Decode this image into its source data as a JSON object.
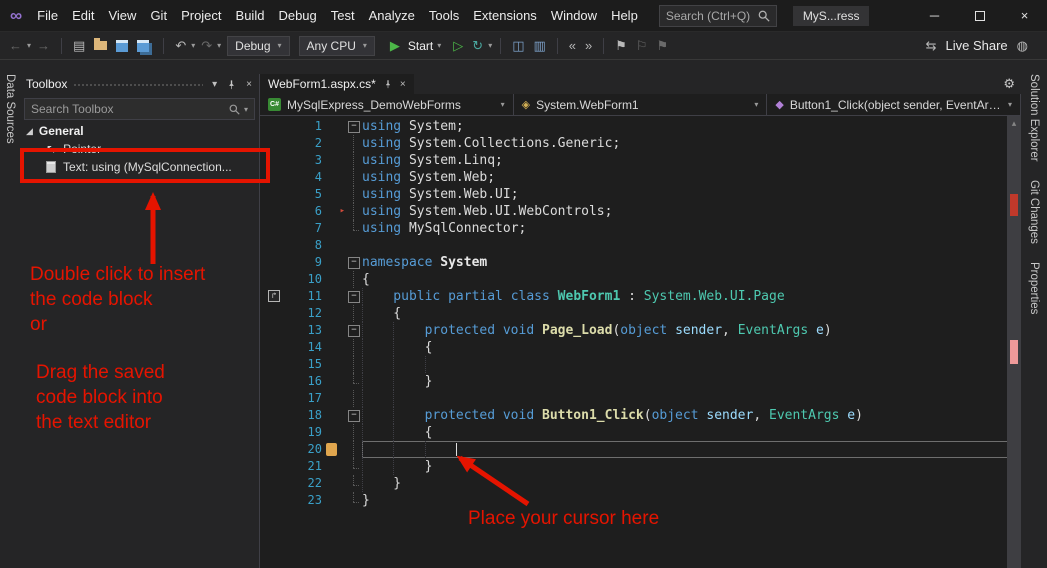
{
  "colors": {
    "annotation_red": "#e51400",
    "keyword_blue": "#569cd6",
    "type_teal": "#4ec9b0",
    "method_yellow": "#dcdcaa"
  },
  "icons": {
    "logo": "∞",
    "minimize": "─",
    "close": "×",
    "back": "←",
    "forward": "→",
    "undo": "↶",
    "redo": "↷",
    "new_item": "▤",
    "start_play": "▶",
    "run_play": "▷",
    "hot_reload": "↻",
    "panel1": "◫",
    "panel2": "▥",
    "indent_out": "«",
    "indent_in": "»",
    "bookmark": "⚑",
    "bookmark2": "⚐",
    "live_share": "⇆",
    "feedback": "◍",
    "gear": "⚙",
    "chevron": "▾",
    "scroll_up": "▴",
    "pointer": "↖",
    "expander": "◢",
    "tracker": "▸",
    "margin_glyph": "↱",
    "tab_close": "×"
  },
  "titlebar": {
    "menu": [
      "File",
      "Edit",
      "View",
      "Git",
      "Project",
      "Build",
      "Debug",
      "Test",
      "Analyze",
      "Tools",
      "Extensions",
      "Window",
      "Help"
    ],
    "search_placeholder": "Search (Ctrl+Q)",
    "window_title": "MyS...ress"
  },
  "toolbar": {
    "debug_target": "Debug",
    "platform": "Any CPU",
    "start_label": "Start",
    "live_share_label": "Live Share"
  },
  "left_strip": {
    "tab": "Data Sources"
  },
  "toolbox": {
    "title": "Toolbox",
    "search_placeholder": "Search Toolbox",
    "section_label": "General",
    "items": [
      {
        "label": "Pointer"
      },
      {
        "label": "Text: using (MySqlConnection..."
      }
    ]
  },
  "annotations": {
    "note_top": "Double click to insert\nthe code block\nor",
    "note_bottom": "Drag the saved\ncode block into\nthe text editor",
    "cursor_note": "Place your cursor here"
  },
  "editor": {
    "tab_label": "WebForm1.aspx.cs*",
    "nav_project": "MySqlExpress_DemoWebForms",
    "nav_type": "System.WebForm1",
    "nav_member": "Button1_Click(object sender, EventArgs)",
    "code_lines": [
      {
        "n": 1,
        "fold": "fb",
        "guides": 0,
        "tokens": [
          [
            "kw",
            "using"
          ],
          [
            "pl",
            " System;"
          ]
        ]
      },
      {
        "n": 2,
        "fold": "fl",
        "guides": 0,
        "tokens": [
          [
            "kw",
            "using"
          ],
          [
            "pl",
            " System.Collections.Generic;"
          ]
        ]
      },
      {
        "n": 3,
        "fold": "fl",
        "guides": 0,
        "tokens": [
          [
            "kw",
            "using"
          ],
          [
            "pl",
            " System.Linq;"
          ]
        ]
      },
      {
        "n": 4,
        "fold": "fl",
        "guides": 0,
        "tokens": [
          [
            "kw",
            "using"
          ],
          [
            "pl",
            " System.Web;"
          ]
        ]
      },
      {
        "n": 5,
        "fold": "fl",
        "guides": 0,
        "tokens": [
          [
            "kw",
            "using"
          ],
          [
            "pl",
            " System.Web.UI;"
          ]
        ]
      },
      {
        "n": 6,
        "fold": "fl",
        "guides": 0,
        "marker": "redarrow",
        "tokens": [
          [
            "kw",
            "using"
          ],
          [
            "pl",
            " System.Web.UI.WebControls;"
          ]
        ]
      },
      {
        "n": 7,
        "fold": "fe",
        "guides": 0,
        "tokens": [
          [
            "kw",
            "using"
          ],
          [
            "pl",
            " MySqlConnector;"
          ]
        ]
      },
      {
        "n": 8,
        "fold": "",
        "guides": 0,
        "tokens": []
      },
      {
        "n": 9,
        "fold": "fb",
        "guides": 0,
        "tokens": [
          [
            "kw",
            "namespace"
          ],
          [
            "ns",
            " System"
          ]
        ]
      },
      {
        "n": 10,
        "fold": "fl",
        "guides": 0,
        "tokens": [
          [
            "pl",
            "{"
          ]
        ]
      },
      {
        "n": 11,
        "fold": "fb",
        "guides": 1,
        "lmicon": true,
        "tokens": [
          [
            "kw",
            "public partial class"
          ],
          [
            "tyb",
            " WebForm1"
          ],
          [
            "pl",
            " : "
          ],
          [
            "ty",
            "System.Web.UI.Page"
          ]
        ]
      },
      {
        "n": 12,
        "fold": "fl",
        "guides": 1,
        "tokens": [
          [
            "pl",
            "{"
          ]
        ]
      },
      {
        "n": 13,
        "fold": "fb",
        "guides": 2,
        "tokens": [
          [
            "kw",
            "protected void"
          ],
          [
            "meb",
            " Page_Load"
          ],
          [
            "pl",
            "("
          ],
          [
            "kw",
            "object"
          ],
          [
            "pa",
            " sender"
          ],
          [
            "pl",
            ", "
          ],
          [
            "ty",
            "EventArgs"
          ],
          [
            "pa",
            " e"
          ],
          [
            "pl",
            ")"
          ]
        ]
      },
      {
        "n": 14,
        "fold": "fl",
        "guides": 2,
        "tokens": [
          [
            "pl",
            "{"
          ]
        ]
      },
      {
        "n": 15,
        "fold": "fl",
        "guides": 3,
        "tokens": []
      },
      {
        "n": 16,
        "fold": "fe",
        "guides": 2,
        "tokens": [
          [
            "pl",
            "}"
          ]
        ]
      },
      {
        "n": 17,
        "fold": "fl",
        "guides": 2,
        "tokens": []
      },
      {
        "n": 18,
        "fold": "fb",
        "guides": 2,
        "tokens": [
          [
            "kw",
            "protected void"
          ],
          [
            "meb",
            " Button1_Click"
          ],
          [
            "pl",
            "("
          ],
          [
            "kw",
            "object"
          ],
          [
            "pa",
            " sender"
          ],
          [
            "pl",
            ", "
          ],
          [
            "ty",
            "EventArgs"
          ],
          [
            "pa",
            " e"
          ],
          [
            "pl",
            ")"
          ]
        ]
      },
      {
        "n": 19,
        "fold": "fl",
        "guides": 2,
        "tokens": [
          [
            "pl",
            "{"
          ]
        ]
      },
      {
        "n": 20,
        "fold": "fl",
        "guides": 3,
        "current": true,
        "caret": true,
        "marker": "modified",
        "tokens": []
      },
      {
        "n": 21,
        "fold": "fe",
        "guides": 2,
        "tokens": [
          [
            "pl",
            "}"
          ]
        ]
      },
      {
        "n": 22,
        "fold": "fe",
        "guides": 1,
        "tokens": [
          [
            "pl",
            "}"
          ]
        ]
      },
      {
        "n": 23,
        "fold": "fe",
        "guides": 0,
        "tokens": [
          [
            "pl",
            "}"
          ]
        ]
      }
    ]
  },
  "right_strip": {
    "tabs": [
      "Solution Explorer",
      "Git Changes",
      "Properties"
    ]
  }
}
